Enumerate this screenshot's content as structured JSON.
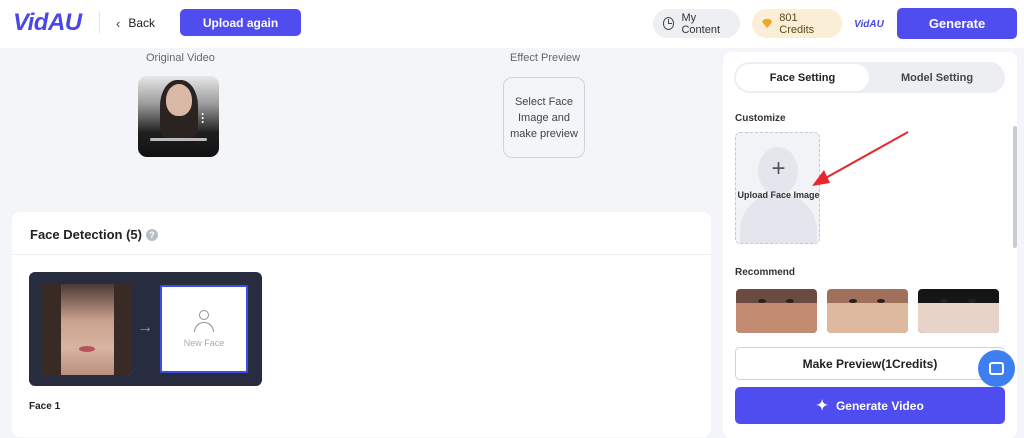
{
  "header": {
    "logo": "VidAU",
    "back_label": "Back",
    "upload_again_label": "Upload again",
    "my_content_label": "My Content",
    "credits_label": "801 Credits",
    "avatar_label": "VidAU",
    "generate_label": "Generate"
  },
  "preview": {
    "original_label": "Original Video",
    "effect_label": "Effect Preview",
    "effect_placeholder": "Select Face Image and make preview"
  },
  "face_detection": {
    "title": "Face Detection (5)",
    "help": "?",
    "new_face_label": "New Face",
    "face_name": "Face 1",
    "arrow": "→"
  },
  "settings": {
    "tabs": [
      {
        "label": "Face Setting",
        "active": true
      },
      {
        "label": "Model Setting",
        "active": false
      }
    ],
    "customize_label": "Customize",
    "upload_face_label": "Upload Face Image",
    "plus": "+",
    "recommend_label": "Recommend",
    "make_preview_label": "Make Preview(1Credits)",
    "generate_video_label": "Generate Video"
  },
  "colors": {
    "accent": "#4f4cf0",
    "annotation_arrow": "#e8262b"
  },
  "icons": [
    "chevron-left-icon",
    "clock-icon",
    "diamond-icon",
    "help-icon",
    "user-icon",
    "plus-icon",
    "sparkle-icon",
    "chat-icon"
  ]
}
